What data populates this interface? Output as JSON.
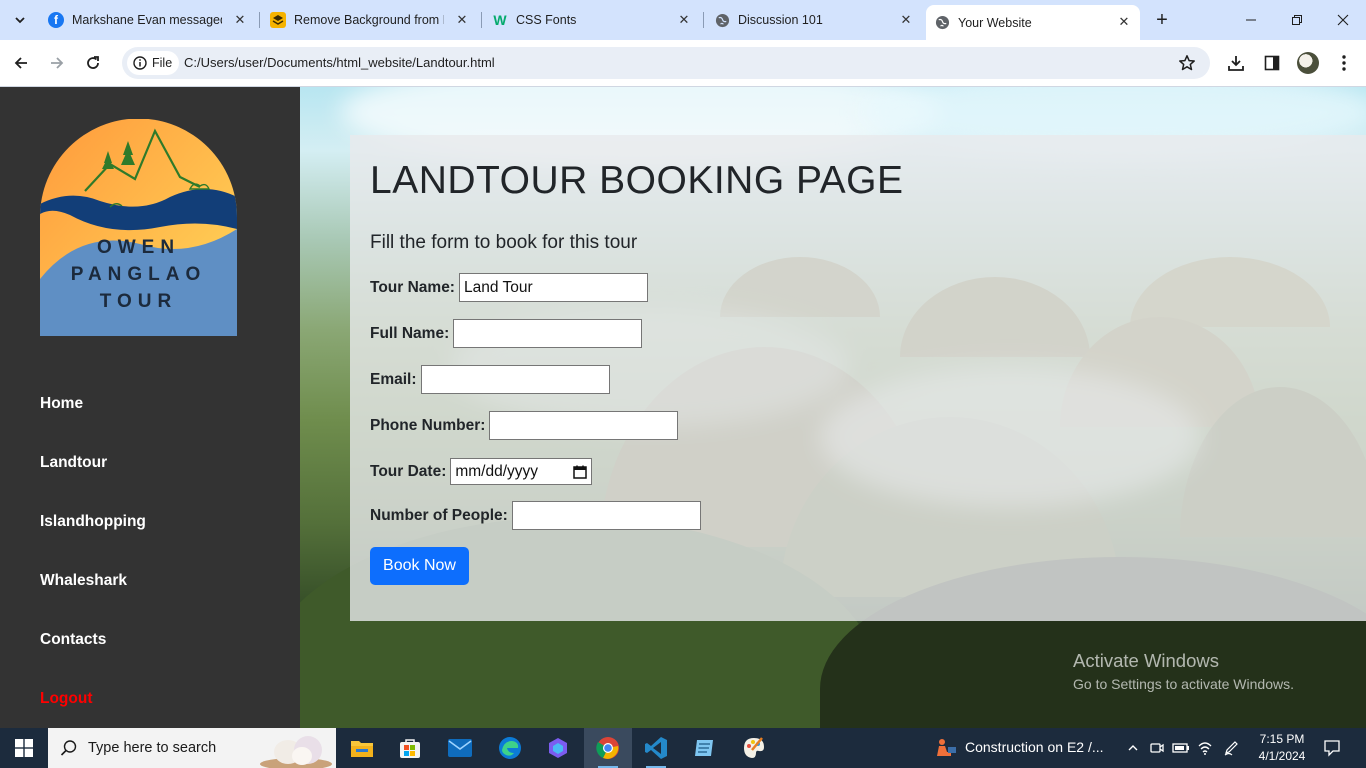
{
  "browser": {
    "tabs": [
      {
        "title": "Markshane Evan messaged y",
        "icon": "facebook-icon",
        "active": false
      },
      {
        "title": "Remove Background from In",
        "icon": "remove-bg-icon",
        "active": false
      },
      {
        "title": "CSS Fonts",
        "icon": "w3schools-icon",
        "active": false
      },
      {
        "title": "Discussion 101",
        "icon": "globe-icon",
        "active": false
      },
      {
        "title": "Your Website",
        "icon": "globe-icon",
        "active": true
      }
    ],
    "file_chip": "File",
    "url": "C:/Users/user/Documents/html_website/Landtour.html"
  },
  "sidebar": {
    "logo": {
      "line1": "OWEN",
      "line2": "PANGLAO",
      "line3": "TOUR"
    },
    "links": [
      {
        "label": "Home"
      },
      {
        "label": "Landtour"
      },
      {
        "label": "Islandhopping"
      },
      {
        "label": "Whaleshark"
      },
      {
        "label": "Contacts"
      },
      {
        "label": "Logout",
        "color": "#ff0000"
      }
    ]
  },
  "booking": {
    "heading": "LANDTOUR BOOKING PAGE",
    "lead": "Fill the form to book for this tour",
    "fields": {
      "tour_name": {
        "label": "Tour Name:",
        "value": "Land Tour"
      },
      "full_name": {
        "label": "Full Name:",
        "value": ""
      },
      "email": {
        "label": "Email:",
        "value": ""
      },
      "phone": {
        "label": "Phone Number:",
        "value": ""
      },
      "tour_date": {
        "label": "Tour Date:",
        "placeholder": "mm/dd/yyyy"
      },
      "people": {
        "label": "Number of People:",
        "value": ""
      }
    },
    "submit": "Book Now",
    "submit_color": "#0d6efd"
  },
  "watermark": {
    "title": "Activate Windows",
    "subtitle": "Go to Settings to activate Windows."
  },
  "taskbar": {
    "search_placeholder": "Type here to search",
    "pinned": [
      "file-explorer-icon",
      "store-icon",
      "mail-icon",
      "edge-icon",
      "copilot-icon",
      "chrome-icon",
      "vscode-icon",
      "notepad-icon",
      "paint-icon"
    ],
    "notification": "Construction on E2 /...",
    "time": "7:15 PM",
    "date": "4/1/2024"
  },
  "colors": {
    "sidebar_bg": "#333333",
    "tabstrip_bg": "#d3e3fd",
    "taskbar_bg": "#1c2b3d"
  }
}
